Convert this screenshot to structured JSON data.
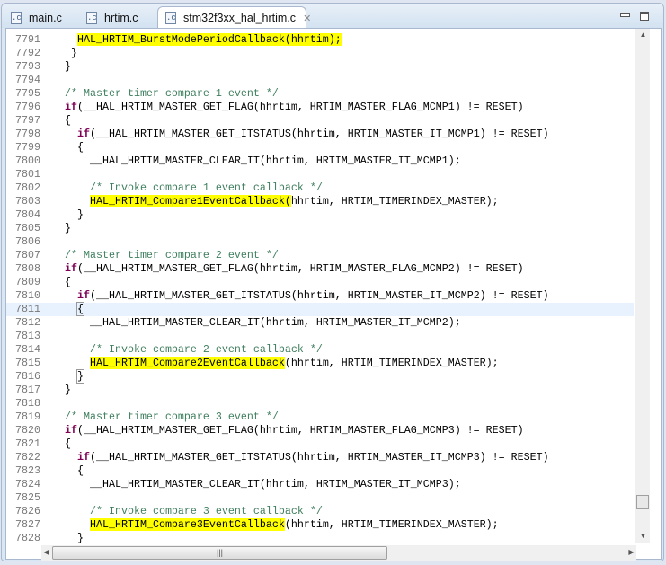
{
  "tabs": [
    {
      "label": "main.c",
      "icon": "c-file-icon",
      "icon_text": ".c"
    },
    {
      "label": "hrtim.c",
      "icon": "c-file-icon",
      "icon_text": ".c"
    },
    {
      "label": "stm32f3xx_hal_hrtim.c",
      "icon": "c-file-icon",
      "icon_text": ".c",
      "active": true,
      "close": "✕"
    }
  ],
  "window": {
    "minimize": "minimize",
    "maximize": "maximize"
  },
  "lines": [
    {
      "n": "7791",
      "i": 4,
      "s": [
        [
          "hl",
          "HAL_HRTIM_BurstModePeriodCallback(hhrtim);"
        ]
      ]
    },
    {
      "n": "7792",
      "i": 3,
      "s": [
        [
          "",
          "}"
        ]
      ]
    },
    {
      "n": "7793",
      "i": 2,
      "s": [
        [
          "",
          "}"
        ]
      ]
    },
    {
      "n": "7794",
      "i": 0,
      "s": []
    },
    {
      "n": "7795",
      "i": 2,
      "s": [
        [
          "cm",
          "/* Master timer compare 1 event */"
        ]
      ]
    },
    {
      "n": "7796",
      "i": 2,
      "s": [
        [
          "kw",
          "if"
        ],
        [
          "",
          "(__HAL_HRTIM_MASTER_GET_FLAG(hhrtim, HRTIM_MASTER_FLAG_MCMP1) != RESET)"
        ]
      ]
    },
    {
      "n": "7797",
      "i": 2,
      "s": [
        [
          "",
          "{"
        ]
      ]
    },
    {
      "n": "7798",
      "i": 4,
      "s": [
        [
          "kw",
          "if"
        ],
        [
          "",
          "(__HAL_HRTIM_MASTER_GET_ITSTATUS(hhrtim, HRTIM_MASTER_IT_MCMP1) != RESET)"
        ]
      ]
    },
    {
      "n": "7799",
      "i": 4,
      "s": [
        [
          "",
          "{"
        ]
      ]
    },
    {
      "n": "7800",
      "i": 6,
      "s": [
        [
          "",
          "__HAL_HRTIM_MASTER_CLEAR_IT(hhrtim, HRTIM_MASTER_IT_MCMP1);"
        ]
      ]
    },
    {
      "n": "7801",
      "i": 0,
      "s": []
    },
    {
      "n": "7802",
      "i": 6,
      "s": [
        [
          "cm",
          "/* Invoke compare 1 event callback */"
        ]
      ]
    },
    {
      "n": "7803",
      "i": 6,
      "s": [
        [
          "hl",
          "HAL_HRTIM_Compare1EventCallback("
        ],
        [
          "",
          "hhrtim, HRTIM_TIMERINDEX_MASTER);"
        ]
      ]
    },
    {
      "n": "7804",
      "i": 4,
      "s": [
        [
          "",
          "}"
        ]
      ]
    },
    {
      "n": "7805",
      "i": 2,
      "s": [
        [
          "",
          "}"
        ]
      ]
    },
    {
      "n": "7806",
      "i": 0,
      "s": []
    },
    {
      "n": "7807",
      "i": 2,
      "s": [
        [
          "cm",
          "/* Master timer compare 2 event */"
        ]
      ]
    },
    {
      "n": "7808",
      "i": 2,
      "s": [
        [
          "kw",
          "if"
        ],
        [
          "",
          "(__HAL_HRTIM_MASTER_GET_FLAG(hhrtim, HRTIM_MASTER_FLAG_MCMP2) != RESET)"
        ]
      ]
    },
    {
      "n": "7809",
      "i": 2,
      "s": [
        [
          "",
          "{"
        ]
      ]
    },
    {
      "n": "7810",
      "i": 4,
      "s": [
        [
          "kw",
          "if"
        ],
        [
          "",
          "(__HAL_HRTIM_MASTER_GET_ITSTATUS(hhrtim, HRTIM_MASTER_IT_MCMP2) != RESET)"
        ]
      ]
    },
    {
      "n": "7811",
      "i": 4,
      "cur": true,
      "s": [
        [
          "br",
          "{"
        ]
      ]
    },
    {
      "n": "7812",
      "i": 6,
      "s": [
        [
          "",
          "__HAL_HRTIM_MASTER_CLEAR_IT(hhrtim, HRTIM_MASTER_IT_MCMP2);"
        ]
      ]
    },
    {
      "n": "7813",
      "i": 0,
      "s": []
    },
    {
      "n": "7814",
      "i": 6,
      "s": [
        [
          "cm",
          "/* Invoke compare 2 event callback */"
        ]
      ]
    },
    {
      "n": "7815",
      "i": 6,
      "s": [
        [
          "hl",
          "HAL_HRTIM_Compare2EventCallback"
        ],
        [
          "",
          "(hhrtim, HRTIM_TIMERINDEX_MASTER);"
        ]
      ]
    },
    {
      "n": "7816",
      "i": 4,
      "s": [
        [
          "br",
          "}"
        ]
      ]
    },
    {
      "n": "7817",
      "i": 2,
      "s": [
        [
          "",
          "}"
        ]
      ]
    },
    {
      "n": "7818",
      "i": 0,
      "s": []
    },
    {
      "n": "7819",
      "i": 2,
      "s": [
        [
          "cm",
          "/* Master timer compare 3 event */"
        ]
      ]
    },
    {
      "n": "7820",
      "i": 2,
      "s": [
        [
          "kw",
          "if"
        ],
        [
          "",
          "(__HAL_HRTIM_MASTER_GET_FLAG(hhrtim, HRTIM_MASTER_FLAG_MCMP3) != RESET)"
        ]
      ]
    },
    {
      "n": "7821",
      "i": 2,
      "s": [
        [
          "",
          "{"
        ]
      ]
    },
    {
      "n": "7822",
      "i": 4,
      "s": [
        [
          "kw",
          "if"
        ],
        [
          "",
          "(__HAL_HRTIM_MASTER_GET_ITSTATUS(hhrtim, HRTIM_MASTER_IT_MCMP3) != RESET)"
        ]
      ]
    },
    {
      "n": "7823",
      "i": 4,
      "s": [
        [
          "",
          "{"
        ]
      ]
    },
    {
      "n": "7824",
      "i": 6,
      "s": [
        [
          "",
          "__HAL_HRTIM_MASTER_CLEAR_IT(hhrtim, HRTIM_MASTER_IT_MCMP3);"
        ]
      ]
    },
    {
      "n": "7825",
      "i": 0,
      "s": []
    },
    {
      "n": "7826",
      "i": 6,
      "s": [
        [
          "cm",
          "/* Invoke compare 3 event callback */"
        ]
      ]
    },
    {
      "n": "7827",
      "i": 6,
      "s": [
        [
          "hl",
          "HAL_HRTIM_Compare3EventCallback"
        ],
        [
          "",
          "(hhrtim, HRTIM_TIMERINDEX_MASTER);"
        ]
      ]
    },
    {
      "n": "7828",
      "i": 4,
      "s": [
        [
          "",
          "}"
        ]
      ]
    }
  ],
  "scrollbars": {
    "vertical_position": 0.93,
    "horizontal_position": 0.0,
    "grip": "|||"
  }
}
